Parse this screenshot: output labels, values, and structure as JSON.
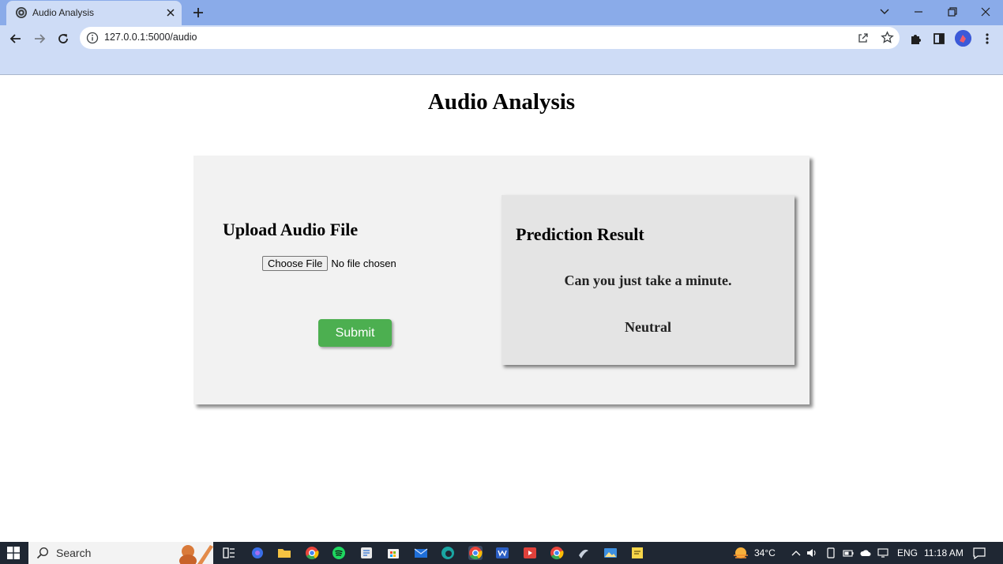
{
  "browser": {
    "tab_title": "Audio Analysis",
    "url": "127.0.0.1:5000/audio"
  },
  "page": {
    "title": "Audio Analysis",
    "upload": {
      "heading": "Upload Audio File",
      "choose_file_label": "Choose File",
      "file_status": "No file chosen",
      "submit_label": "Submit"
    },
    "result": {
      "heading": "Prediction Result",
      "transcript": "Can you just take a minute.",
      "emotion": "Neutral"
    }
  },
  "taskbar": {
    "search_label": "Search",
    "temperature": "34°C",
    "language": "ENG",
    "time": "11:18 AM"
  },
  "colors": {
    "tabstrip": "#8aabe9",
    "toolbar": "#cedcf6",
    "submit": "#4caf50",
    "card": "#f2f2f2",
    "result_card": "#e4e4e4",
    "taskbar": "#1f2733"
  }
}
